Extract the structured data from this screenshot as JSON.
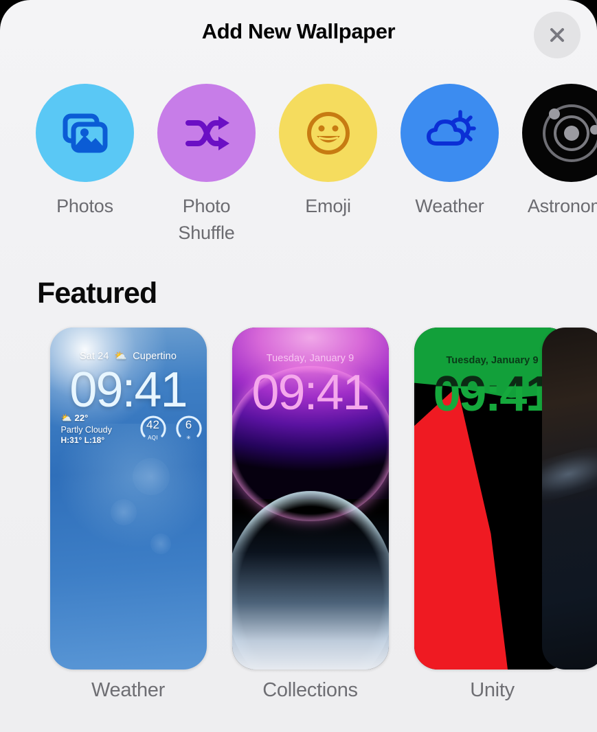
{
  "header": {
    "title": "Add New Wallpaper",
    "close_icon": "close-icon",
    "close_label": "Close"
  },
  "categories": [
    {
      "id": "photos",
      "label": "Photos",
      "icon": "photos-icon",
      "circle_color": "#5AC8F5",
      "glyph_color": "#0B5CD5"
    },
    {
      "id": "photo-shuffle",
      "label": "Photo\nShuffle",
      "icon": "shuffle-icon",
      "circle_color": "#C77DE8",
      "glyph_color": "#6B0FC4"
    },
    {
      "id": "emoji",
      "label": "Emoji",
      "icon": "emoji-icon",
      "circle_color": "#F5DC5E",
      "glyph_color": "#C77B12"
    },
    {
      "id": "weather",
      "label": "Weather",
      "icon": "weather-icon",
      "circle_color": "#3C8CF0",
      "glyph_color": "#0B2FD5"
    },
    {
      "id": "astronomy",
      "label": "Astronomy",
      "icon": "astronomy-icon",
      "circle_color": "#050505",
      "glyph_color": "#8A8A8F"
    }
  ],
  "featured": {
    "section_title": "Featured",
    "cards": [
      {
        "id": "weather",
        "label": "Weather",
        "preview": {
          "date": "Sat 24",
          "location": "Cupertino",
          "time": "09:41",
          "temperature": "22°",
          "condition": "Partly Cloudy",
          "high_low": "H:31° L:18°",
          "aqi_value": "42",
          "aqi_caption": "AQI",
          "uv_value": "6",
          "uv_caption": "UV"
        }
      },
      {
        "id": "collections",
        "label": "Collections",
        "preview": {
          "date": "Tuesday, January 9",
          "time": "09:41"
        }
      },
      {
        "id": "unity",
        "label": "Unity",
        "preview": {
          "date": "Tuesday, January 9",
          "time": "09:41"
        }
      },
      {
        "id": "peek",
        "label": "",
        "preview": {}
      }
    ]
  }
}
